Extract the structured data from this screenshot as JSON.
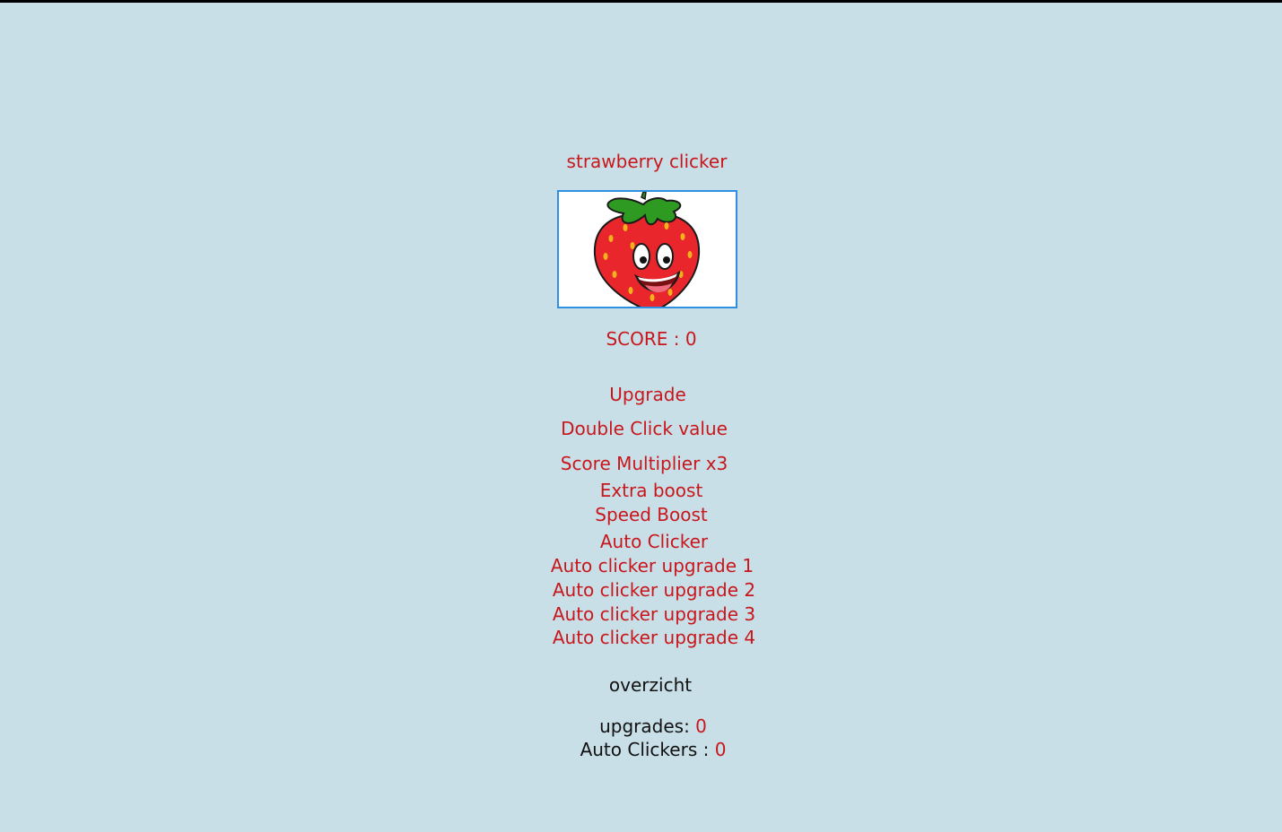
{
  "title": "strawberry clicker",
  "strawberry_image": {
    "icon": "strawberry-face-icon"
  },
  "score": {
    "label": "SCORE : ",
    "value": "0"
  },
  "upgrades_heading": "Upgrade",
  "upgrade_buttons": {
    "double_click": "Double Click value",
    "score_multiplier": "Score Multiplier x3",
    "extra_boost": "Extra boost",
    "speed_boost": "Speed Boost",
    "auto_clicker": "Auto Clicker",
    "auto_upgrade_1": "Auto clicker upgrade 1",
    "auto_upgrade_2": "Auto clicker upgrade 2",
    "auto_upgrade_3": "Auto clicker upgrade 3",
    "auto_upgrade_4": "Auto clicker upgrade 4"
  },
  "overview": {
    "heading": "overzicht",
    "upgrades_label": "upgrades: ",
    "upgrades_value": "0",
    "auto_clickers_label": "Auto Clickers : ",
    "auto_clickers_value": "0"
  },
  "colors": {
    "background": "#c8dfe7",
    "accent": "#c8171c",
    "image_border": "#2f8fe0"
  }
}
